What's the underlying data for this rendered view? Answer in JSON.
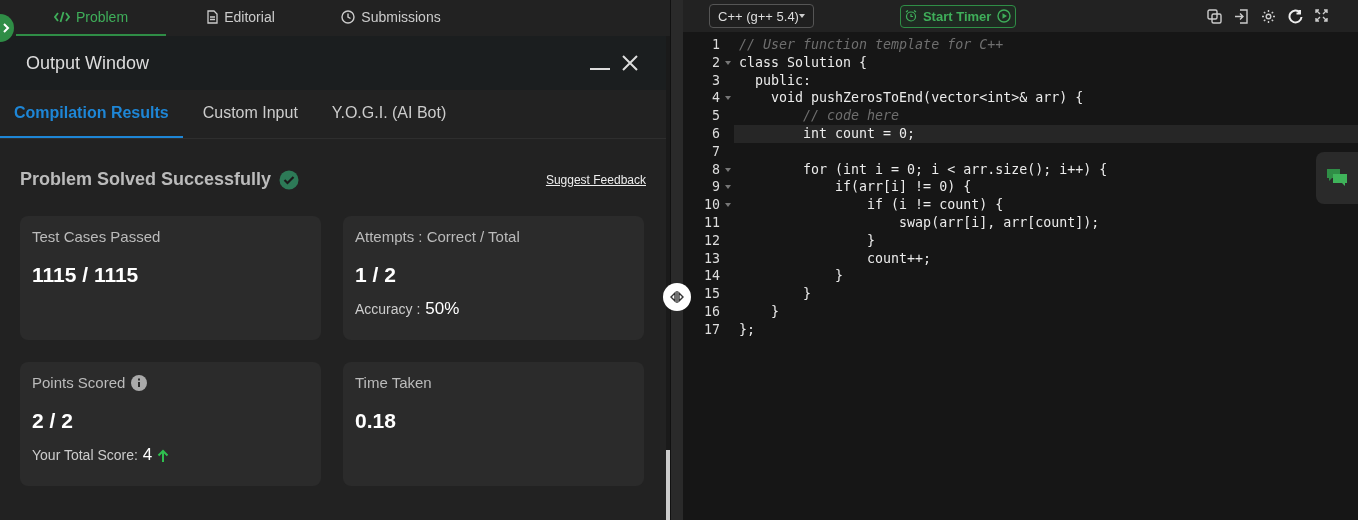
{
  "problem_tabs": [
    {
      "label": "Problem",
      "selected": true
    },
    {
      "label": "Editorial",
      "selected": false
    },
    {
      "label": "Submissions",
      "selected": false
    }
  ],
  "output_window": {
    "title": "Output Window",
    "tabs": [
      {
        "label": "Compilation Results",
        "selected": true
      },
      {
        "label": "Custom Input",
        "selected": false
      },
      {
        "label": "Y.O.G.I. (AI Bot)",
        "selected": false
      }
    ],
    "status": "Problem Solved Successfully",
    "feedback_link": "Suggest Feedback",
    "cards": [
      {
        "title": "Test Cases Passed",
        "value": "1115 / 1115"
      },
      {
        "title": "Attempts : Correct / Total",
        "value": "1 / 2",
        "detail_label": "Accuracy :",
        "detail_value": "50%"
      },
      {
        "title": "Points Scored",
        "value": "2 / 2",
        "detail_label": "Your Total Score:",
        "detail_value": "4"
      },
      {
        "title": "Time Taken",
        "value": "0.18"
      }
    ]
  },
  "editor": {
    "language": "C++ (g++ 5.4)",
    "timer_button": "Start Timer",
    "lines": [
      {
        "n": "1",
        "fold": false,
        "current": false,
        "kind": "comment",
        "text": "// User function template for C++"
      },
      {
        "n": "2",
        "fold": true,
        "current": false,
        "kind": "code",
        "text": "class Solution {"
      },
      {
        "n": "3",
        "fold": false,
        "current": false,
        "kind": "code",
        "text": "  public:"
      },
      {
        "n": "4",
        "fold": true,
        "current": false,
        "kind": "code",
        "text": "    void pushZerosToEnd(vector<int>& arr) {"
      },
      {
        "n": "5",
        "fold": false,
        "current": false,
        "kind": "comment",
        "text": "        // code here"
      },
      {
        "n": "6",
        "fold": false,
        "current": true,
        "kind": "code",
        "text": "        int count = 0;"
      },
      {
        "n": "7",
        "fold": false,
        "current": false
      },
      {
        "n": "8",
        "fold": true,
        "current": false,
        "kind": "code",
        "text": "        for (int i = 0; i < arr.size(); i++) {"
      },
      {
        "n": "9",
        "fold": true,
        "current": false,
        "kind": "code",
        "text": "            if(arr[i] != 0) {"
      },
      {
        "n": "10",
        "fold": true,
        "current": false,
        "kind": "code",
        "text": "                if (i != count) {"
      },
      {
        "n": "11",
        "fold": false,
        "current": false,
        "kind": "code",
        "text": "                    swap(arr[i], arr[count]);"
      },
      {
        "n": "12",
        "fold": false,
        "current": false,
        "kind": "code",
        "text": "                }"
      },
      {
        "n": "13",
        "fold": false,
        "current": false,
        "kind": "code",
        "text": "                count++;"
      },
      {
        "n": "14",
        "fold": false,
        "current": false,
        "kind": "code",
        "text": "            }"
      },
      {
        "n": "15",
        "fold": false,
        "current": false,
        "kind": "code",
        "text": "        }"
      },
      {
        "n": "16",
        "fold": false,
        "current": false,
        "kind": "code",
        "text": "    }"
      },
      {
        "n": "17",
        "fold": false,
        "current": false,
        "kind": "code",
        "text": "};"
      }
    ]
  }
}
